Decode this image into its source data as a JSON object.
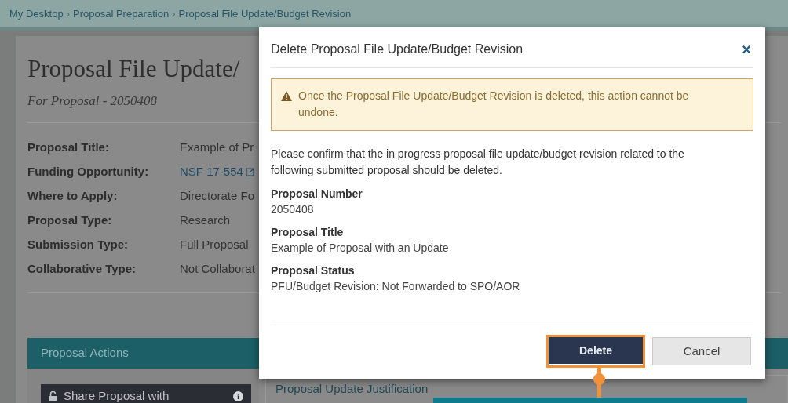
{
  "breadcrumb": {
    "separator": "›",
    "items": [
      {
        "label": "My Desktop"
      },
      {
        "label": "Proposal Preparation"
      },
      {
        "label": "Proposal File Update/Budget Revision"
      }
    ]
  },
  "page": {
    "title": "Proposal File Update/",
    "subtitle": "For Proposal - 2050408",
    "details": [
      {
        "label": "Proposal Title:",
        "value": "Example of Pr",
        "kind": "text"
      },
      {
        "label": "Funding Opportunity:",
        "value": "NSF 17-554",
        "kind": "link"
      },
      {
        "label": "Where to Apply:",
        "value": "Directorate Fo",
        "kind": "text"
      },
      {
        "label": "Proposal Type:",
        "value": "Research",
        "kind": "text"
      },
      {
        "label": "Submission Type:",
        "value": "Full Proposal",
        "kind": "text"
      },
      {
        "label": "Collaborative Type:",
        "value": "Not Collaborat",
        "kind": "text"
      }
    ],
    "actions_panel": {
      "title": "Proposal Actions",
      "buttons": [
        {
          "label": "Share Proposal with"
        }
      ]
    },
    "right_panel": {
      "section_title": "Proposal Update Justification"
    }
  },
  "modal": {
    "title": "Delete Proposal File Update/Budget Revision",
    "close": "×",
    "warning": "Once the Proposal File Update/Budget Revision is deleted, this action cannot be undone.",
    "message": "Please confirm that the in progress proposal file update/budget revision related to the following submitted proposal should be deleted.",
    "fields": [
      {
        "label": "Proposal Number",
        "value": "2050408"
      },
      {
        "label": "Proposal Title",
        "value": "Example of Proposal with an Update"
      },
      {
        "label": "Proposal Status",
        "value": "PFU/Budget Revision: Not Forwarded to SPO/AOR"
      }
    ],
    "buttons": [
      {
        "label": "Delete",
        "kind": "primary",
        "highlighted": true
      },
      {
        "label": "Cancel",
        "kind": "secondary",
        "highlighted": false
      }
    ]
  }
}
